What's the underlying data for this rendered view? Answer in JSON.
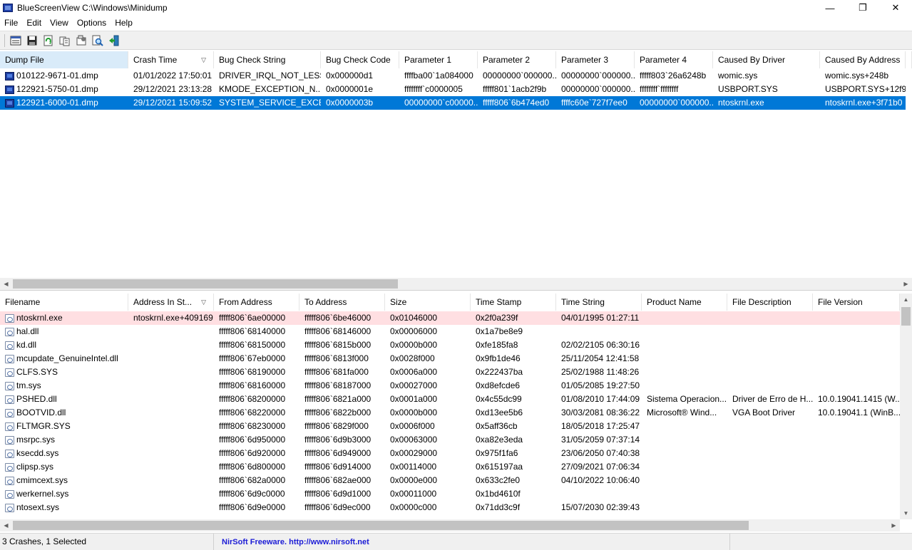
{
  "window": {
    "title": "BlueScreenView    C:\\Windows\\Minidump"
  },
  "menu": [
    "File",
    "Edit",
    "View",
    "Options",
    "Help"
  ],
  "toolbar": [
    "options-icon",
    "save-icon",
    "refresh-icon",
    "copy-icon",
    "properties-icon",
    "find-icon",
    "exit-icon"
  ],
  "crash_table": {
    "columns": [
      "Dump File",
      "Crash Time",
      "Bug Check String",
      "Bug Check Code",
      "Parameter 1",
      "Parameter 2",
      "Parameter 3",
      "Parameter 4",
      "Caused By Driver",
      "Caused By Address",
      ""
    ],
    "rows": [
      [
        "010122-9671-01.dmp",
        "01/01/2022 17:50:01",
        "DRIVER_IRQL_NOT_LESS...",
        "0x000000d1",
        "ffffba00`1a084000",
        "00000000`000000...",
        "00000000`000000...",
        "fffff803`26a6248b",
        "womic.sys",
        "womic.sys+248b"
      ],
      [
        "122921-5750-01.dmp",
        "29/12/2021 23:13:28",
        "KMODE_EXCEPTION_N...",
        "0x0000001e",
        "ffffffff`c0000005",
        "fffff801`1acb2f9b",
        "00000000`000000...",
        "ffffffff`ffffffff",
        "USBPORT.SYS",
        "USBPORT.SYS+12f9b"
      ],
      [
        "122921-6000-01.dmp",
        "29/12/2021 15:09:52",
        "SYSTEM_SERVICE_EXCEP...",
        "0x0000003b",
        "00000000`c00000...",
        "fffff806`6b474ed0",
        "ffffc60e`727f7ee0",
        "00000000`000000...",
        "ntoskrnl.exe",
        "ntoskrnl.exe+3f71b0"
      ]
    ]
  },
  "driver_table": {
    "columns": [
      "Filename",
      "Address In St...",
      "From Address",
      "To Address",
      "Size",
      "Time Stamp",
      "Time String",
      "Product Name",
      "File Description",
      "File Version"
    ],
    "rows": [
      [
        "ntoskrnl.exe",
        "ntoskrnl.exe+409169",
        "fffff806`6ae00000",
        "fffff806`6be46000",
        "0x01046000",
        "0x2f0a239f",
        "04/01/1995 01:27:11",
        "",
        "",
        ""
      ],
      [
        "hal.dll",
        "",
        "fffff806`68140000",
        "fffff806`68146000",
        "0x00006000",
        "0x1a7be8e9",
        "",
        "",
        "",
        ""
      ],
      [
        "kd.dll",
        "",
        "fffff806`68150000",
        "fffff806`6815b000",
        "0x0000b000",
        "0xfe185fa8",
        "02/02/2105 06:30:16",
        "",
        "",
        ""
      ],
      [
        "mcupdate_GenuineIntel.dll",
        "",
        "fffff806`67eb0000",
        "fffff806`6813f000",
        "0x0028f000",
        "0x9fb1de46",
        "25/11/2054 12:41:58",
        "",
        "",
        ""
      ],
      [
        "CLFS.SYS",
        "",
        "fffff806`68190000",
        "fffff806`681fa000",
        "0x0006a000",
        "0x222437ba",
        "25/02/1988 11:48:26",
        "",
        "",
        ""
      ],
      [
        "tm.sys",
        "",
        "fffff806`68160000",
        "fffff806`68187000",
        "0x00027000",
        "0xd8efcde6",
        "01/05/2085 19:27:50",
        "",
        "",
        ""
      ],
      [
        "PSHED.dll",
        "",
        "fffff806`68200000",
        "fffff806`6821a000",
        "0x0001a000",
        "0x4c55dc99",
        "01/08/2010 17:44:09",
        "Sistema Operacion...",
        "Driver de Erro de H...",
        "10.0.19041.1415 (W..."
      ],
      [
        "BOOTVID.dll",
        "",
        "fffff806`68220000",
        "fffff806`6822b000",
        "0x0000b000",
        "0xd13ee5b6",
        "30/03/2081 08:36:22",
        "Microsoft® Wind...",
        "VGA Boot Driver",
        "10.0.19041.1 (WinB..."
      ],
      [
        "FLTMGR.SYS",
        "",
        "fffff806`68230000",
        "fffff806`6829f000",
        "0x0006f000",
        "0x5aff36cb",
        "18/05/2018 17:25:47",
        "",
        "",
        ""
      ],
      [
        "msrpc.sys",
        "",
        "fffff806`6d950000",
        "fffff806`6d9b3000",
        "0x00063000",
        "0xa82e3eda",
        "31/05/2059 07:37:14",
        "",
        "",
        ""
      ],
      [
        "ksecdd.sys",
        "",
        "fffff806`6d920000",
        "fffff806`6d949000",
        "0x00029000",
        "0x975f1fa6",
        "23/06/2050 07:40:38",
        "",
        "",
        ""
      ],
      [
        "clipsp.sys",
        "",
        "fffff806`6d800000",
        "fffff806`6d914000",
        "0x00114000",
        "0x615197aa",
        "27/09/2021 07:06:34",
        "",
        "",
        ""
      ],
      [
        "cmimcext.sys",
        "",
        "fffff806`682a0000",
        "fffff806`682ae000",
        "0x0000e000",
        "0x633c2fe0",
        "04/10/2022 10:06:40",
        "",
        "",
        ""
      ],
      [
        "werkernel.sys",
        "",
        "fffff806`6d9c0000",
        "fffff806`6d9d1000",
        "0x00011000",
        "0x1bd4610f",
        "",
        "",
        "",
        ""
      ],
      [
        "ntosext.sys",
        "",
        "fffff806`6d9e0000",
        "fffff806`6d9ec000",
        "0x0000c000",
        "0x71dd3c9f",
        "15/07/2030 02:39:43",
        "",
        "",
        ""
      ]
    ]
  },
  "status": {
    "crashes": "3 Crashes, 1 Selected",
    "link": "NirSoft Freeware.  http://www.nirsoft.net"
  }
}
